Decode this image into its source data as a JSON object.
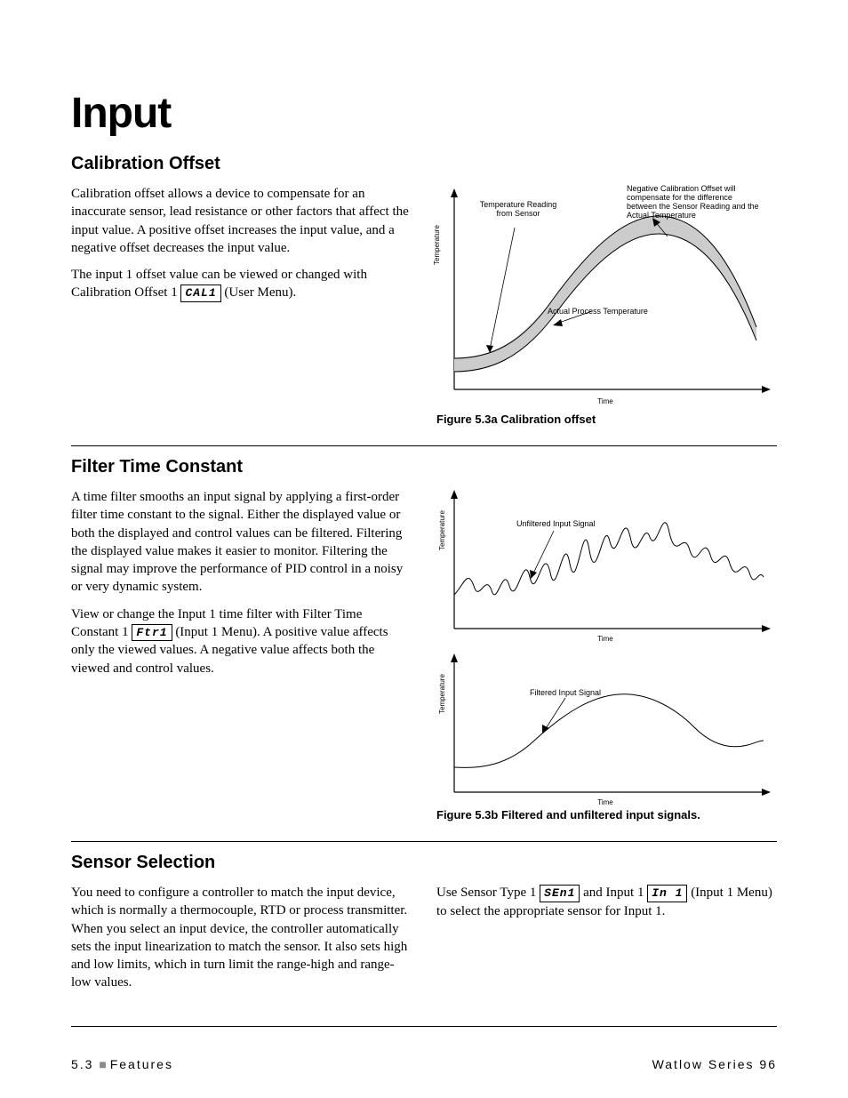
{
  "title": "Input",
  "sections": {
    "calibration": {
      "heading": "Calibration Offset",
      "p1": "Calibration offset allows a device to compensate for an inaccurate sensor, lead resistance or other factors that affect the input value. A positive offset increases the input value, and a negative offset decreases the input value.",
      "p2a": "The input 1 offset value can be viewed or changed with Calibration Offset 1 ",
      "p2_param": "CAL1",
      "p2b": " (User Menu).",
      "figure": {
        "caption": "Figure 5.3a Calibration offset",
        "labels": {
          "tempReading": "Temperature Reading from Sensor",
          "negOffset": "Negative Calibration Offset will compensate for the difference between the Sensor Reading and the Actual Temperature",
          "actual": "Actual Process Temperature",
          "ylabel": "Temperature",
          "xlabel": "Time"
        }
      }
    },
    "filter": {
      "heading": "Filter Time Constant",
      "p1": "A time filter smooths an input signal by applying a first-order filter time constant to the signal. Either the displayed value or both the displayed and control values can be filtered. Filtering the displayed value makes it easier to monitor. Filtering the signal may improve the performance of PID control in a noisy or very dynamic system.",
      "p2a": "View or change the Input 1 time filter with Filter Time Constant 1 ",
      "p2_param": "Ftr1",
      "p2b": " (Input 1 Menu). A positive value affects only the viewed values. A negative value affects both the viewed and control values.",
      "figure": {
        "caption": "Figure 5.3b Filtered and unfiltered input signals.",
        "labels": {
          "unfiltered": "Unfiltered Input Signal",
          "filtered": "Filtered Input Signal",
          "ylabel": "Temperature",
          "xlabel": "Time"
        }
      }
    },
    "sensor": {
      "heading": "Sensor Selection",
      "left_p": "You need to configure a controller to match the input device, which is normally a thermocouple, RTD or process transmitter. When you select an input device, the controller automatically sets the input linearization to match the sensor. It also sets high and low limits, which in turn limit the range-high and range-low values.",
      "right_a": "Use Sensor Type 1 ",
      "right_param1": "SEn1",
      "right_b": " and Input 1 ",
      "right_param2": "In 1",
      "right_c": " (Input 1 Menu) to select the appropriate sensor for Input 1."
    }
  },
  "footer": {
    "left_a": "5.3",
    "left_b": "Features",
    "right": "Watlow Series 96"
  }
}
